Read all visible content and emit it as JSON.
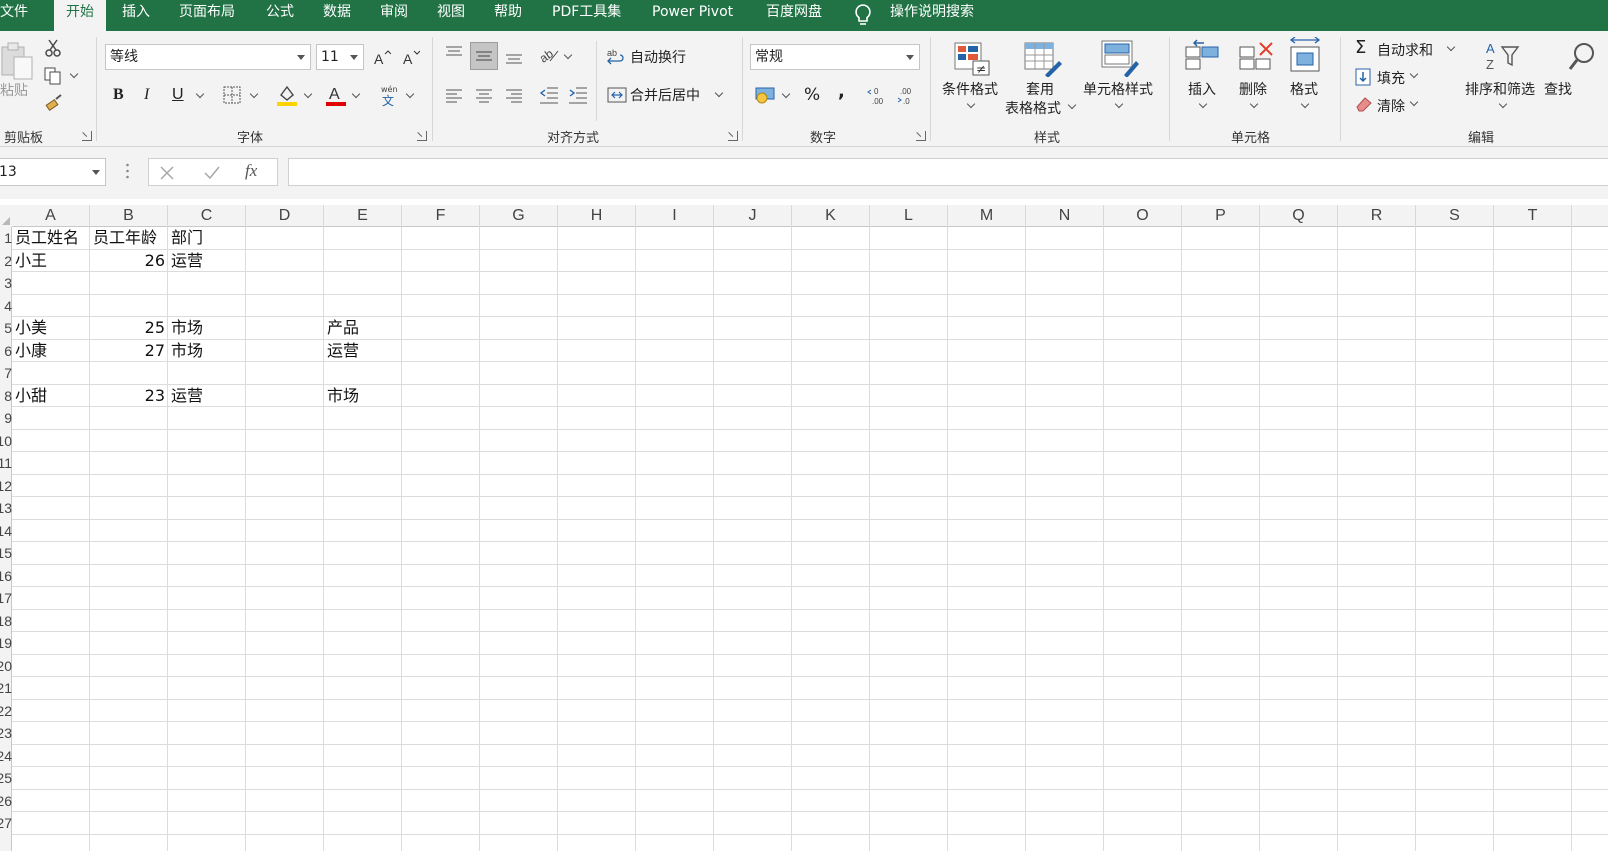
{
  "tabs": [
    {
      "label": "文件"
    },
    {
      "label": "开始"
    },
    {
      "label": "插入"
    },
    {
      "label": "页面布局"
    },
    {
      "label": "公式"
    },
    {
      "label": "数据"
    },
    {
      "label": "审阅"
    },
    {
      "label": "视图"
    },
    {
      "label": "帮助"
    },
    {
      "label": "PDF工具集"
    },
    {
      "label": "Power Pivot"
    },
    {
      "label": "百度网盘"
    }
  ],
  "tell_me": "操作说明搜索",
  "ribbon": {
    "clipboard": {
      "label": "剪贴板",
      "paste": "粘贴"
    },
    "font": {
      "label": "字体",
      "name": "等线",
      "size": "11",
      "bold": "B",
      "italic": "I",
      "underline": "U"
    },
    "alignment": {
      "label": "对齐方式",
      "wrap": "自动换行",
      "merge": "合并后居中"
    },
    "number": {
      "label": "数字",
      "format": "常规",
      "percent": "%",
      "comma": ","
    },
    "styles": {
      "label": "样式",
      "conditional": "条件格式",
      "table_fmt_1": "套用",
      "table_fmt_2": "表格格式",
      "cell_styles": "单元格样式"
    },
    "cells": {
      "label": "单元格",
      "insert": "插入",
      "delete": "删除",
      "format": "格式"
    },
    "editing": {
      "label": "编辑",
      "autosum": "自动求和",
      "fill": "填充",
      "clear": "清除",
      "sort_filter": "排序和筛选",
      "find": "查找"
    }
  },
  "formula_bar": {
    "name_box": "13",
    "fx": "fx",
    "value": ""
  },
  "columns": [
    "A",
    "B",
    "C",
    "D",
    "E",
    "F",
    "G",
    "H",
    "I",
    "J",
    "K",
    "L",
    "M",
    "N",
    "O",
    "P",
    "Q",
    "R",
    "S",
    "T"
  ],
  "rows": [
    "1",
    "2",
    "3",
    "4",
    "5",
    "6",
    "7",
    "8",
    "9",
    "10",
    "11",
    "12",
    "13",
    "14",
    "15",
    "16",
    "17",
    "18",
    "19",
    "20",
    "21",
    "22",
    "23",
    "24",
    "25",
    "26",
    "27"
  ],
  "cells": {
    "A1": "员工姓名",
    "B1": "员工年龄",
    "C1": "部门",
    "A2": "小王",
    "B2": "26",
    "C2": "运营",
    "A5": "小美",
    "B5": "25",
    "C5": "市场",
    "E5": "产品",
    "A6": "小康",
    "B6": "27",
    "C6": "市场",
    "E6": "运营",
    "A8": "小甜",
    "B8": "23",
    "C8": "运营",
    "E8": "市场"
  },
  "colors": {
    "accent": "#217346",
    "ribbon_bg": "#f3f3f3",
    "gridline": "#dcdcdc"
  }
}
